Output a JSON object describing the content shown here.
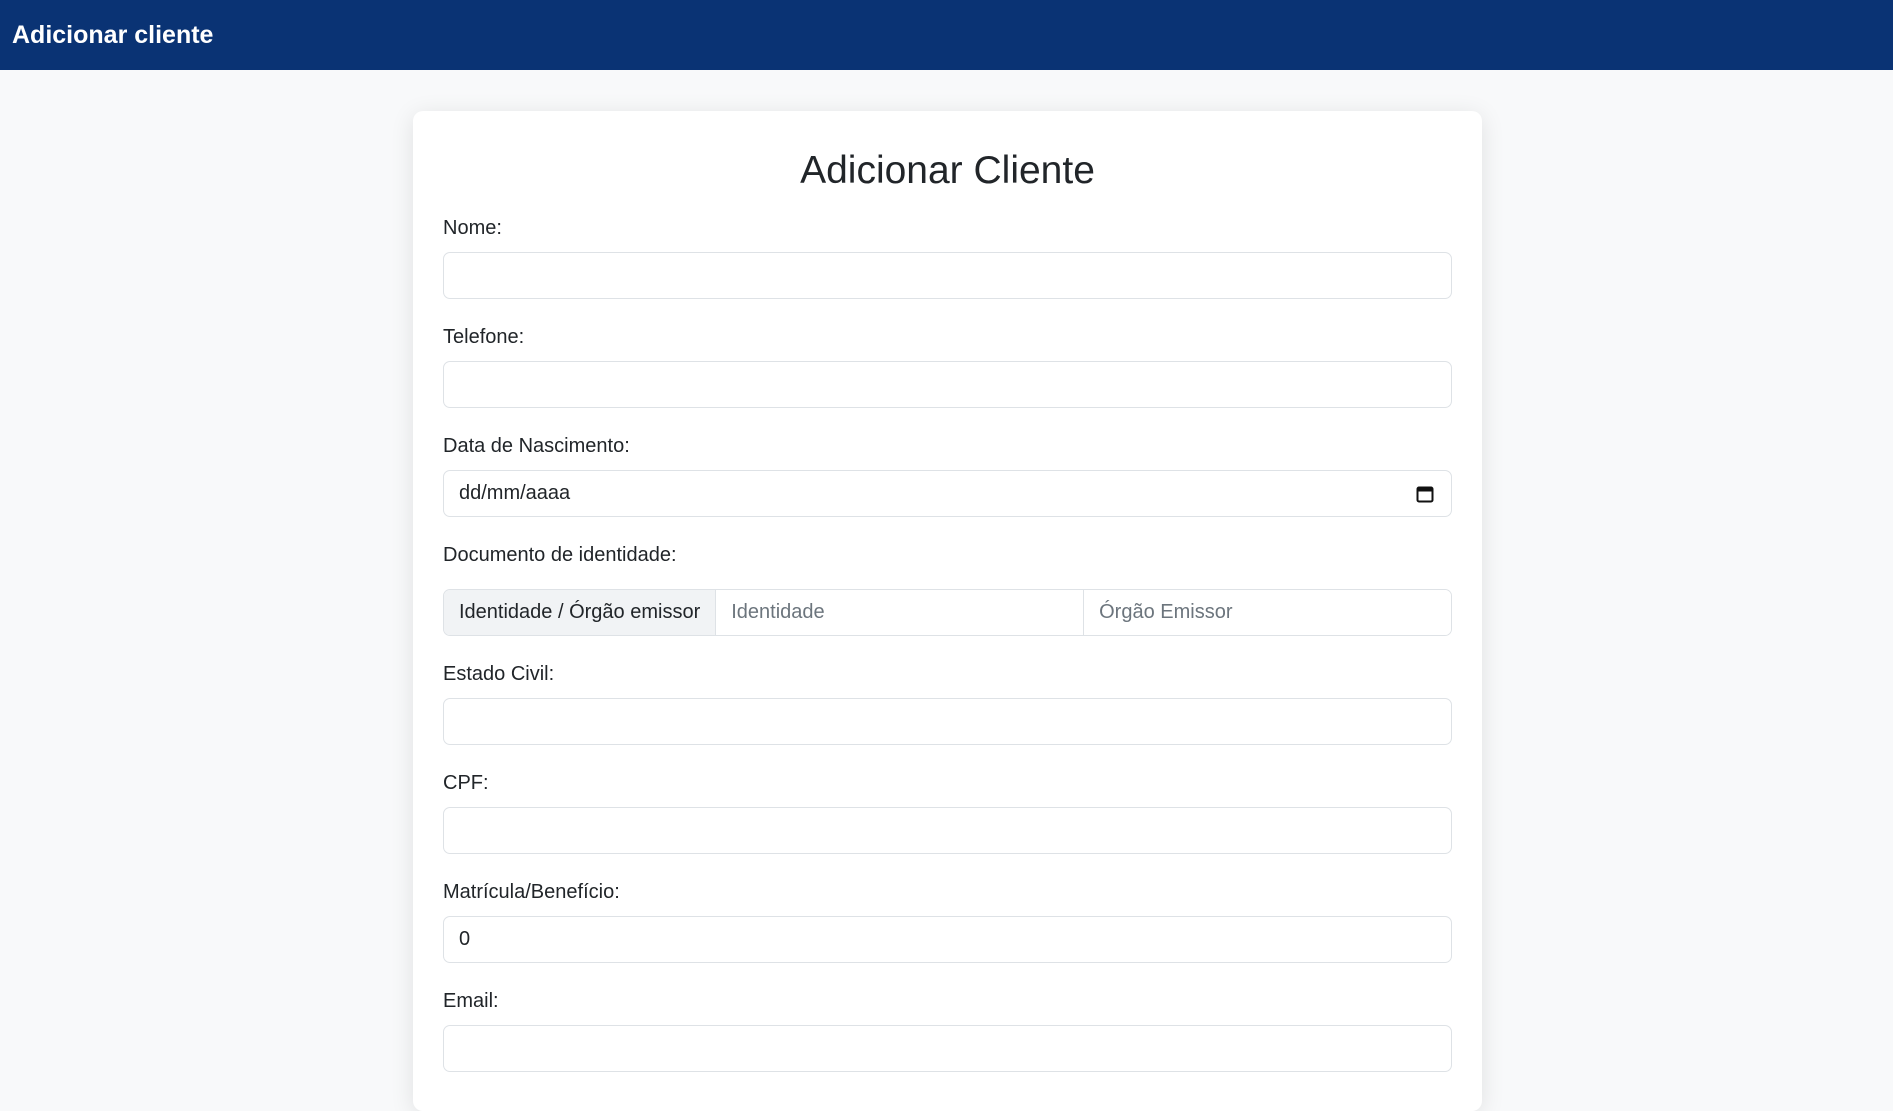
{
  "navbar": {
    "brand": "Adicionar cliente"
  },
  "page": {
    "title": "Adicionar Cliente"
  },
  "form": {
    "nome": {
      "label": "Nome:",
      "value": ""
    },
    "telefone": {
      "label": "Telefone:",
      "value": ""
    },
    "nascimento": {
      "label": "Data de Nascimento:",
      "value": "dd/mm/aaaa"
    },
    "documento": {
      "label": "Documento de identidade:",
      "prefix": "Identidade / Órgão emissor",
      "identidade_placeholder": "Identidade",
      "orgao_placeholder": "Órgão Emissor"
    },
    "estado_civil": {
      "label": "Estado Civil:",
      "value": ""
    },
    "cpf": {
      "label": "CPF:",
      "value": ""
    },
    "matricula": {
      "label": "Matrícula/Benefício:",
      "value": "0"
    },
    "email": {
      "label": "Email:",
      "value": ""
    }
  },
  "colors": {
    "navbar_bg": "#0a3374",
    "page_bg": "#f8f9fa",
    "input_border": "#dee2e6"
  },
  "icons": {
    "date_picker": "calendar-icon"
  }
}
